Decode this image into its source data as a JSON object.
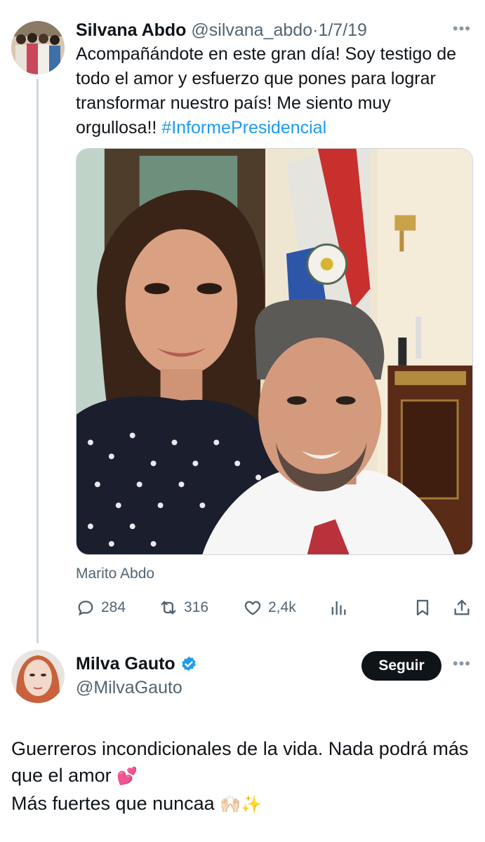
{
  "tweet1": {
    "name": "Silvana Abdo",
    "handle": "@silvana_abdo",
    "separator": "·",
    "date": "1/7/19",
    "text": "Acompañándote en este gran día! Soy testigo de todo el amor y esfuerzo que pones para lograr transformar nuestro país! Me siento muy orgullosa!! ",
    "hashtag": "#InformePresidencial",
    "tagged_person": "Marito Abdo",
    "more_label": "•••",
    "stats": {
      "replies": "284",
      "retweets": "316",
      "likes": "2,4k"
    }
  },
  "tweet2": {
    "name": "Milva Gauto",
    "handle": "@MilvaGauto",
    "follow_label": "Seguir",
    "more_label": "•••",
    "line1": "Guerreros incondicionales de la vida. Nada podrá más que el amor ",
    "emoji1": "💕",
    "line2": "Más fuertes que nuncaa ",
    "emoji2": "🙌🏻✨"
  },
  "colors": {
    "link": "#1d9bf0",
    "muted": "#536471",
    "verified": "#1d9bf0",
    "button_bg": "#0f1419"
  },
  "icons": [
    "reply-icon",
    "retweet-icon",
    "like-icon",
    "views-icon",
    "bookmark-icon",
    "share-icon",
    "verified-badge-icon",
    "more-icon"
  ]
}
